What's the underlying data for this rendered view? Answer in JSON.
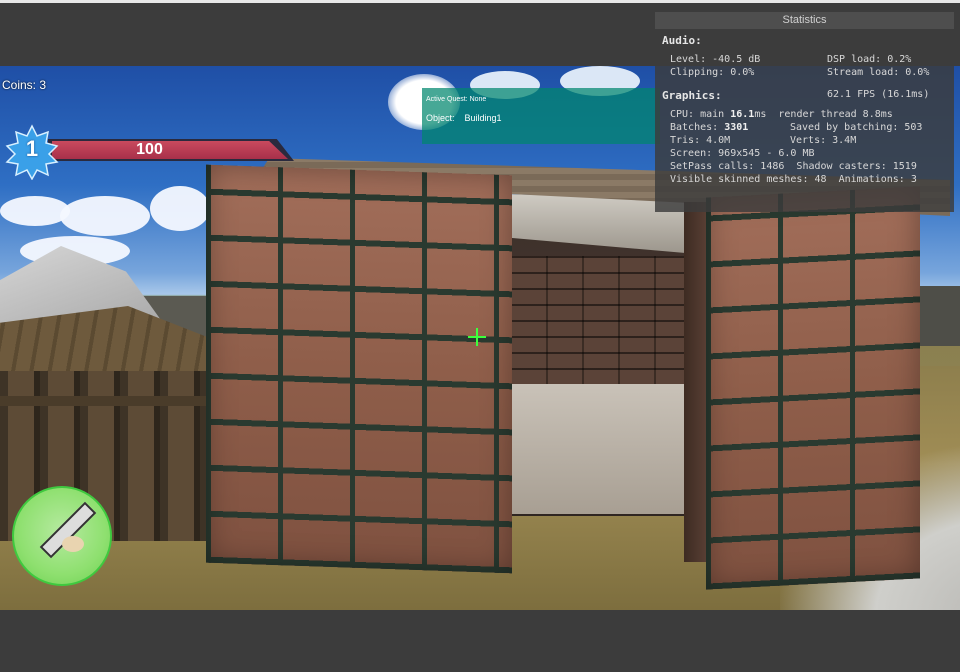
{
  "hud": {
    "coins_label": "Coins: 3",
    "level": "1",
    "health_value": "100",
    "health_fraction": 1.0,
    "quest_line": "Active Quest: None",
    "object_label": "Object:",
    "object_value": "Building1"
  },
  "statistics": {
    "title": "Statistics",
    "audio_header": "Audio:",
    "audio_level": "Level: -40.5 dB",
    "audio_dsp": "DSP load: 0.2%",
    "audio_clipping": "Clipping: 0.0%",
    "audio_stream": "Stream load: 0.0%",
    "graphics_header": "Graphics:",
    "fps": "62.1 FPS (16.1ms)",
    "cpu_prefix": "CPU: main ",
    "cpu_main": "16.1",
    "cpu_suffix": "ms  render thread 8.8ms",
    "batches_prefix": "Batches: ",
    "batches_value": "3301",
    "saved_by_batching": "Saved by batching: 503",
    "tris": "Tris: 4.0M",
    "verts": "Verts: 3.4M",
    "screen": "Screen: 969x545 - 6.0 MB",
    "setpass": "SetPass calls: 1486  Shadow casters: 1519",
    "skinned": "Visible skinned meshes: 48  Animations: 3"
  },
  "colors": {
    "health_fill": "#b8364f",
    "quest_panel": "#00876e",
    "crosshair": "#3cff3c",
    "minimap_ring": "#3fc93f"
  },
  "icons": {
    "level_badge": "star-badge-icon",
    "crosshair": "crosshair-icon"
  }
}
